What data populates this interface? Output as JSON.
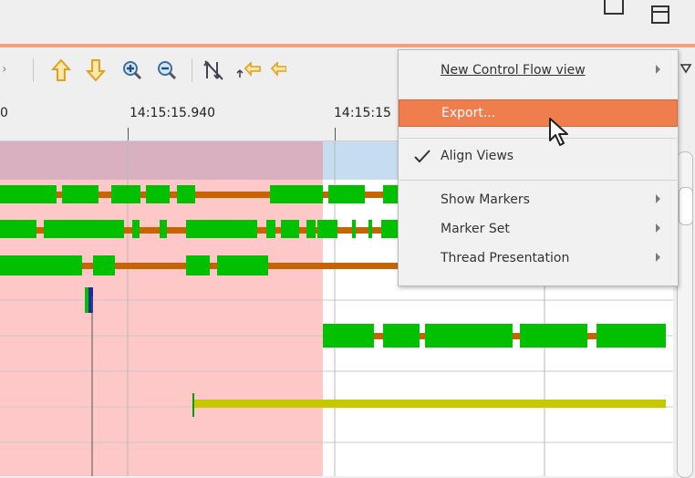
{
  "ruler": {
    "ticks": [
      {
        "label": "0"
      },
      {
        "label": "14:15:15.940"
      },
      {
        "label": "14:15:15"
      }
    ]
  },
  "toolbar": {
    "icons": [
      "arrow-up-icon",
      "arrow-down-icon",
      "zoom-in-icon",
      "zoom-out-icon",
      "hide-arrows-icon",
      "follow-arrow-back-icon",
      "follow-arrow-forward-icon",
      "view-menu-icon"
    ]
  },
  "context_menu": {
    "items": [
      {
        "label": "New Control Flow view",
        "submenu": true,
        "mnemonic": "N"
      },
      {
        "label": "Export...",
        "highlighted": true
      },
      {
        "label": "Align Views",
        "checked": true
      },
      {
        "label": "Show Markers",
        "submenu": true
      },
      {
        "label": "Marker Set",
        "submenu": true
      },
      {
        "label": "Thread Presentation",
        "submenu": true
      }
    ]
  },
  "colors": {
    "accent": "#f0a27f",
    "menu_highlight": "#ef7d4d",
    "running": "#00c000",
    "waiting": "#c86400",
    "interrupted": "#c8c800",
    "selection_pink": "#ffc8c8",
    "selection_blue": "#c6dcf0"
  }
}
